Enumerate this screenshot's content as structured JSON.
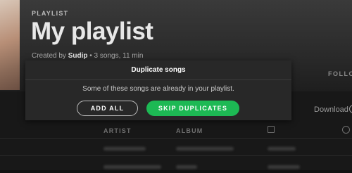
{
  "header": {
    "kicker": "PLAYLIST",
    "title": "My playlist",
    "created_by_prefix": "Created by ",
    "owner": "Sudip",
    "stats": " • 3 songs, 11 min",
    "follow_label": "FOLLO"
  },
  "toolbar": {
    "download_label": "Download"
  },
  "columns": {
    "artist": "ARTIST",
    "album": "ALBUM"
  },
  "dialog": {
    "title": "Duplicate songs",
    "message": "Some of these songs are already in your playlist.",
    "add_all_label": "ADD ALL",
    "skip_label": "SKIP DUPLICATES"
  },
  "colors": {
    "accent": "#1db954",
    "dialog_bg": "#282828",
    "page_bg": "#121212"
  }
}
